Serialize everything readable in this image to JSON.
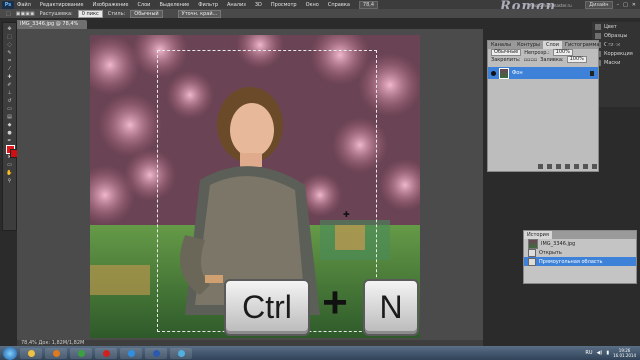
{
  "menubar": {
    "app_badge": "Ps",
    "items": [
      "Файл",
      "Редактирование",
      "Изображение",
      "Слои",
      "Выделение",
      "Фильтр",
      "Анализ",
      "3D",
      "Просмотр",
      "Окно",
      "Справка"
    ],
    "zoom": "78,4",
    "workspace_button": "Дизайн"
  },
  "options": {
    "feather_label": "Растушевка:",
    "feather_value": "0 пикс",
    "style_label": "Стиль:",
    "style_value": "Обычный",
    "refine_button": "Уточн. край..."
  },
  "document": {
    "tab_title": "IMG_3346.jpg @ 78,4% (RGB/8)",
    "status_text": "78,4%   Док: 1,82M/1,82M"
  },
  "overlay": {
    "key1": "Ctrl",
    "plus": "+",
    "key2": "N"
  },
  "panels": {
    "right_icons": [
      {
        "label": "Цвет",
        "icon": "color-icon"
      },
      {
        "label": "Образцы",
        "icon": "swatches-icon"
      },
      {
        "label": "Стили",
        "icon": "styles-icon"
      },
      {
        "label": "Коррекция",
        "icon": "adjustments-icon"
      },
      {
        "label": "Маски",
        "icon": "masks-icon"
      }
    ]
  },
  "layers_panel": {
    "tabs": [
      "Каналы",
      "Контуры",
      "Слои",
      "Гистограмма",
      "Инфо"
    ],
    "active_tab": 2,
    "blend_mode": "Обычные",
    "opacity_label": "Непрозр.:",
    "opacity_value": "100%",
    "lock_label": "Закрепить:",
    "fill_label": "Заливка:",
    "fill_value": "100%",
    "layer_name": "Фон"
  },
  "history_panel": {
    "title": "История",
    "items": [
      "IMG_3346.jpg",
      "Открыть",
      "Прямоугольная область"
    ],
    "active_index": 2
  },
  "watermark": {
    "text": "Roman",
    "subtext": "Photoshop-master.ru"
  },
  "taskbar": {
    "apps": [
      {
        "icon": "explorer-icon",
        "color": "#f0c040"
      },
      {
        "icon": "media-player-icon",
        "color": "#e07a20"
      },
      {
        "icon": "chrome-icon",
        "color": "#3aa040"
      },
      {
        "icon": "opera-icon",
        "color": "#d02020"
      },
      {
        "icon": "photoshop-icon",
        "color": "#2f8fe0"
      },
      {
        "icon": "word-icon",
        "color": "#2a5ab0"
      },
      {
        "icon": "paint-icon",
        "color": "#50b0e0"
      }
    ],
    "language": "RU",
    "time": "19:26",
    "date": "16.01.2014"
  },
  "colors": {
    "foreground": "#e0161b",
    "background": "#d01010",
    "selection_accent": "#3d82d8"
  }
}
